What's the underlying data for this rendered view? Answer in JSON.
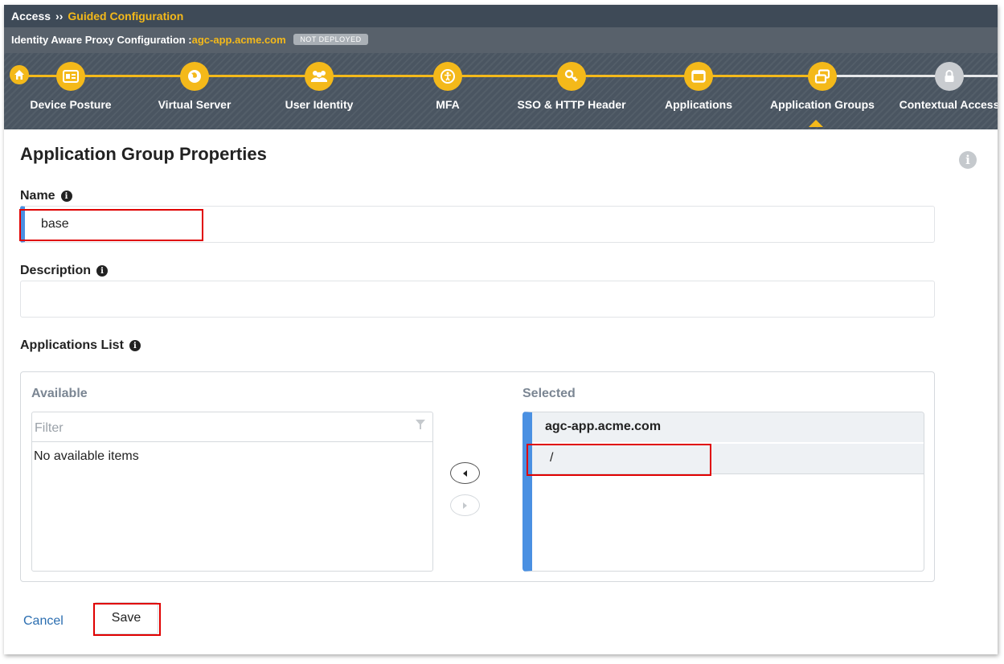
{
  "breadcrumb": {
    "root": "Access",
    "separator": "››",
    "current": "Guided Configuration"
  },
  "config": {
    "prefix": "Identity Aware Proxy Configuration :",
    "host": "agc-app.acme.com",
    "status": "NOT DEPLOYED"
  },
  "steps": [
    {
      "label": "Device Posture",
      "icon": "id-card-icon",
      "state": "done"
    },
    {
      "label": "Virtual Server",
      "icon": "globe-icon",
      "state": "done"
    },
    {
      "label": "User Identity",
      "icon": "users-icon",
      "state": "done"
    },
    {
      "label": "MFA",
      "icon": "accessibility-icon",
      "state": "done"
    },
    {
      "label": "SSO & HTTP Header",
      "icon": "key-icon",
      "state": "done"
    },
    {
      "label": "Applications",
      "icon": "window-icon",
      "state": "done"
    },
    {
      "label": "Application Groups",
      "icon": "windows-group-icon",
      "state": "current"
    },
    {
      "label": "Contextual Access",
      "icon": "lock-icon",
      "state": "locked"
    }
  ],
  "page": {
    "title": "Application Group Properties"
  },
  "form": {
    "name_label": "Name",
    "name_value": "base",
    "description_label": "Description",
    "description_value": "",
    "apps_label": "Applications List"
  },
  "available": {
    "title": "Available",
    "filter_placeholder": "Filter",
    "empty_text": "No available items"
  },
  "selected": {
    "title": "Selected",
    "group": "agc-app.acme.com",
    "items": [
      "/"
    ]
  },
  "actions": {
    "cancel": "Cancel",
    "save": "Save"
  },
  "colors": {
    "accent": "#f4b91a",
    "header_dark": "#3e4a57",
    "selection_blue": "#4a90e2",
    "highlight_red": "#e00000"
  }
}
